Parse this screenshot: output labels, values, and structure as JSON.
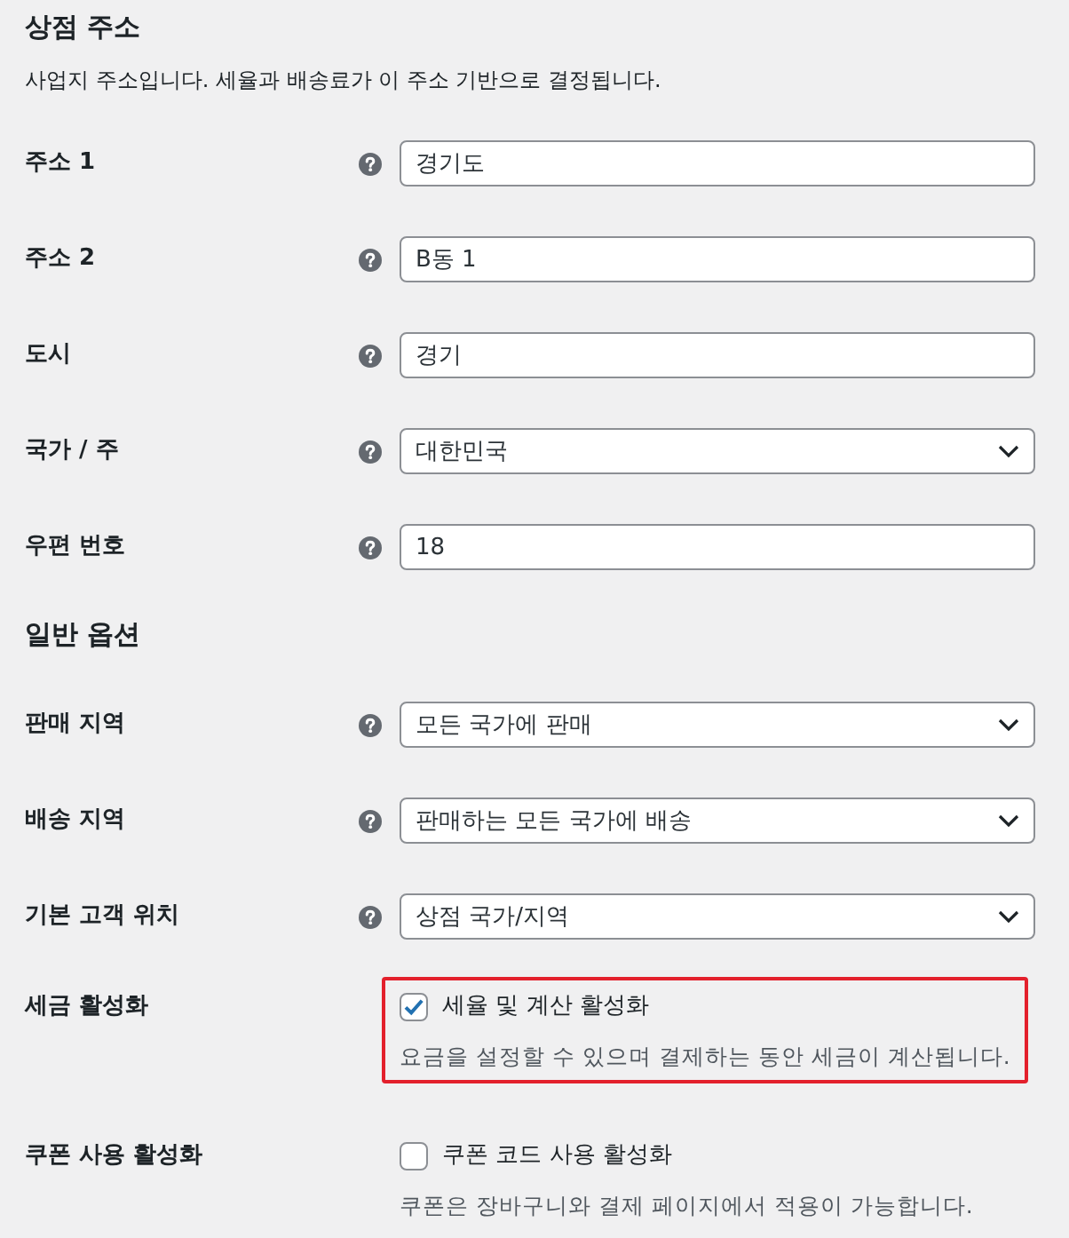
{
  "sections": [
    {
      "title": "상점 주소",
      "description": "사업지 주소입니다. 세율과 배송료가 이 주소 기반으로 결정됩니다.",
      "fields": [
        {
          "label": "주소 1",
          "kind": "text",
          "value": "경기도"
        },
        {
          "label": "주소 2",
          "kind": "text",
          "value": "B동 1"
        },
        {
          "label": "도시",
          "kind": "text",
          "value": "경기"
        },
        {
          "label": "국가 / 주",
          "kind": "select",
          "value": "대한민국"
        },
        {
          "label": "우편 번호",
          "kind": "text",
          "value": "18"
        }
      ]
    },
    {
      "title": "일반 옵션",
      "fields": [
        {
          "label": "판매 지역",
          "kind": "select",
          "value": "모든 국가에 판매"
        },
        {
          "label": "배송 지역",
          "kind": "select",
          "value": "판매하는 모든 국가에 배송"
        },
        {
          "label": "기본 고객 위치",
          "kind": "select",
          "value": "상점 국가/지역"
        },
        {
          "label": "세금 활성화",
          "kind": "checkbox",
          "checked": true,
          "option": "세율 및 계산 활성화",
          "description": "요금을 설정할 수 있으며 결제하는 동안 세금이 계산됩니다.",
          "highlighted": true
        },
        {
          "label": "쿠폰 사용 활성화",
          "kind": "checkbox",
          "checked": false,
          "option": "쿠폰 코드 사용 활성화",
          "description": "쿠폰은 장바구니와 결제 페이지에서 적용이 가능합니다.",
          "highlighted": false
        }
      ]
    }
  ]
}
